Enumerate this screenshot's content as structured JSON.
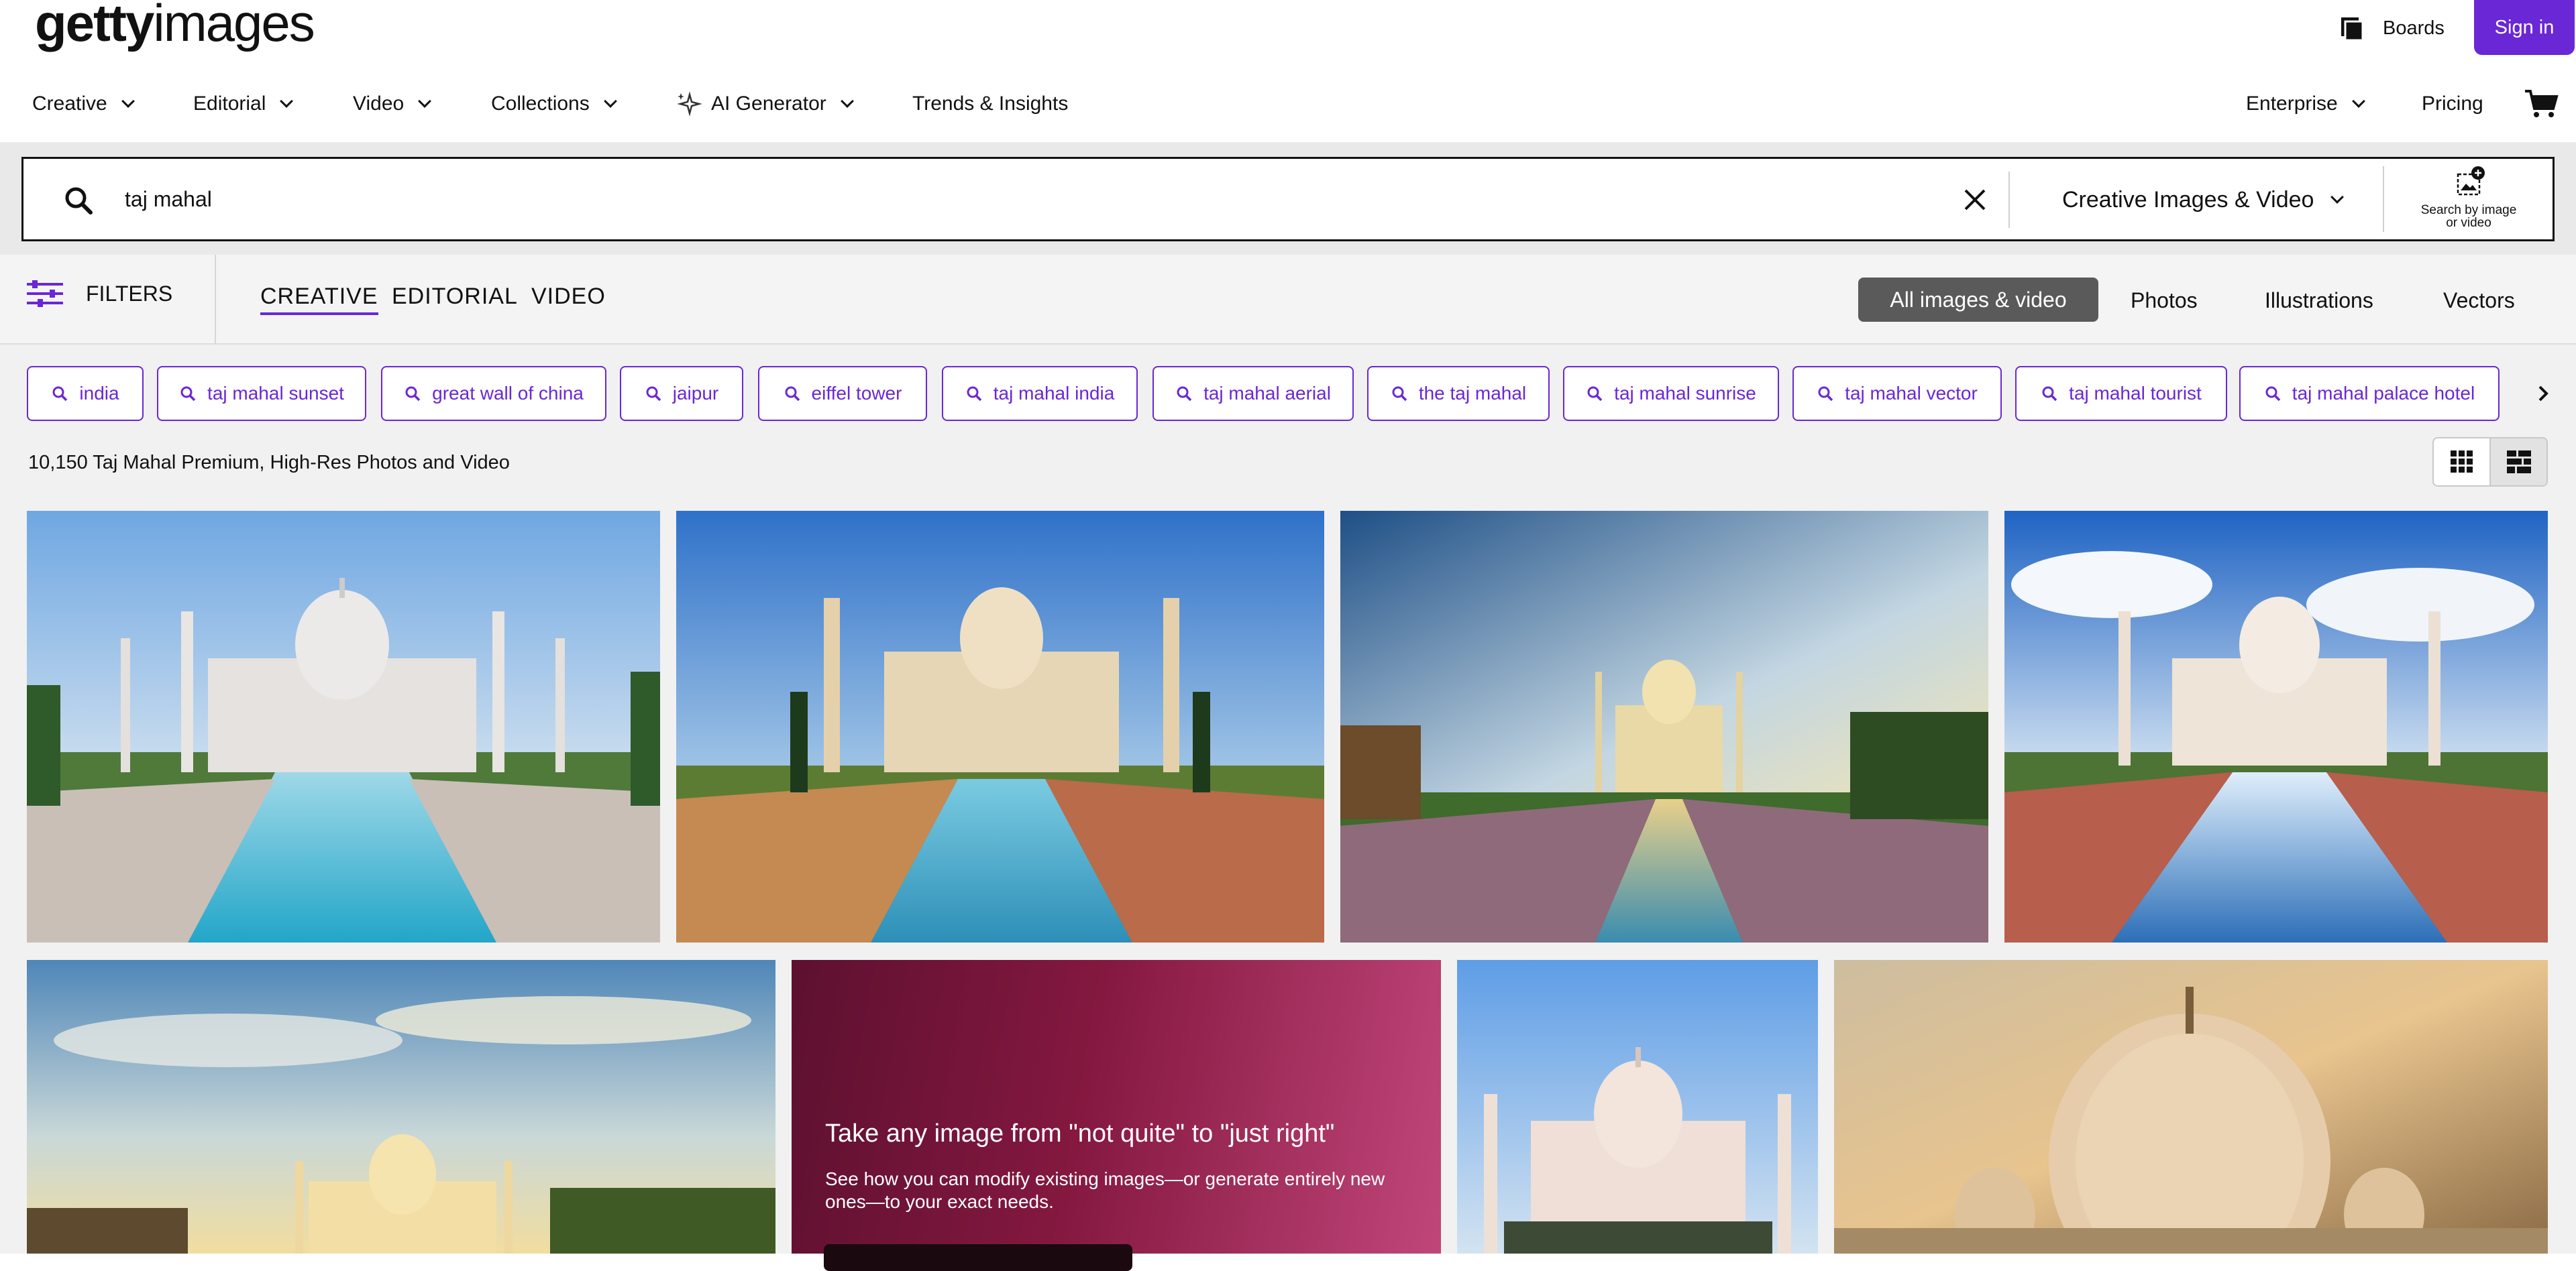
{
  "brand": {
    "logo_bold": "getty",
    "logo_light": "images",
    "accent": "#6a27d6"
  },
  "header": {
    "boards_label": "Boards",
    "signin_label": "Sign in"
  },
  "nav": {
    "items": [
      {
        "label": "Creative"
      },
      {
        "label": "Editorial"
      },
      {
        "label": "Video"
      },
      {
        "label": "Collections"
      },
      {
        "label": "AI Generator"
      },
      {
        "label": "Trends & Insights"
      }
    ],
    "right": {
      "enterprise": "Enterprise",
      "pricing": "Pricing"
    }
  },
  "search": {
    "query": "taj mahal",
    "scope": "Creative Images & Video",
    "by_image_label_1": "Search by image",
    "by_image_label_2": "or video"
  },
  "filters": {
    "label": "FILTERS",
    "tabs": [
      "CREATIVE",
      "EDITORIAL",
      "VIDEO"
    ],
    "media_types": [
      "All images & video",
      "Photos",
      "Illustrations",
      "Vectors"
    ],
    "selected_media": "All images & video"
  },
  "related": {
    "chips": [
      "india",
      "taj mahal sunset",
      "great wall of china",
      "jaipur",
      "eiffel tower",
      "taj mahal india",
      "taj mahal aerial",
      "the taj mahal",
      "taj mahal sunrise",
      "taj mahal vector",
      "taj mahal tourist",
      "taj mahal palace hotel"
    ]
  },
  "results": {
    "count_text": "10,150 Taj Mahal Premium, High-Res Photos and Video"
  },
  "promo": {
    "title": "Take any image from \"not quite\" to \"just right\"",
    "body": "See how you can modify existing images—or generate entirely new ones—to your exact needs."
  }
}
